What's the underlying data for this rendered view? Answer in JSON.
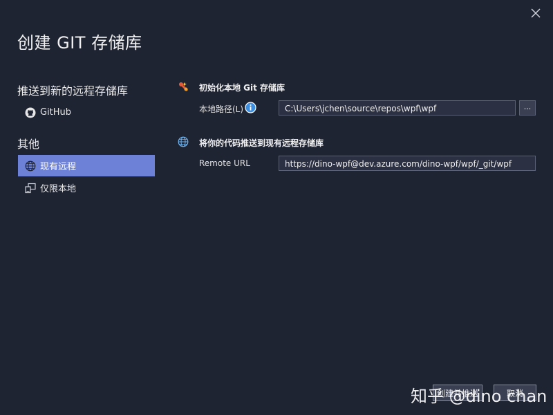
{
  "dialog": {
    "title": "创建 GIT 存储库"
  },
  "sidebar": {
    "push_new_heading": "推送到新的远程存储库",
    "github_label": "GitHub",
    "other_heading": "其他",
    "items": [
      {
        "label": "现有远程",
        "active": true
      },
      {
        "label": "仅限本地",
        "active": false
      }
    ]
  },
  "init_section": {
    "title": "初始化本地 Git 存储库",
    "path_label": "本地路径(L)",
    "path_value": "C:\\Users\\jchen\\source\\repos\\wpf\\wpf",
    "browse_label": "..."
  },
  "push_section": {
    "title": "将你的代码推送到现有远程存储库",
    "remote_label": "Remote URL",
    "remote_value": "https://dino-wpf@dev.azure.com/dino-wpf/wpf/_git/wpf"
  },
  "footer": {
    "create_label": "创建并推送",
    "cancel_label": "取消"
  },
  "watermark": {
    "text": "知乎 @dino chan"
  },
  "colors": {
    "background": "#1f2433",
    "accent": "#6d82d6"
  }
}
